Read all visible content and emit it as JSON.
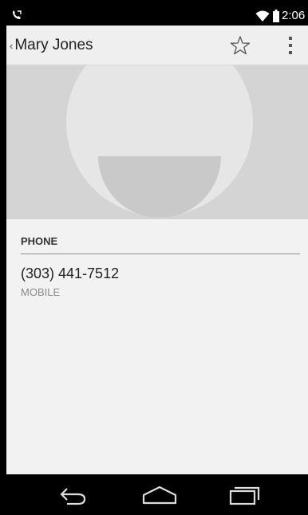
{
  "status_bar": {
    "time": "2:06",
    "icons": [
      "call-icon",
      "wifi-icon",
      "battery-icon"
    ]
  },
  "action_bar": {
    "back_chevron": "‹",
    "title": "Mary Jones",
    "icons": [
      "star-outline-icon",
      "overflow-menu-icon"
    ]
  },
  "photo": {
    "icon": "default-contact-avatar-icon"
  },
  "phone_section": {
    "header": "PHONE",
    "number": "(303) 441-7512",
    "type": "MOBILE"
  },
  "nav_bar": {
    "icons": [
      "back-icon",
      "home-icon",
      "recents-icon"
    ]
  },
  "colors": {
    "status_bar": "#000000",
    "action_bar": "#efefef",
    "photo_background": "#d4d4d4",
    "avatar_face": "#e6e6e6",
    "avatar_mouth": "#c9c9c9"
  }
}
